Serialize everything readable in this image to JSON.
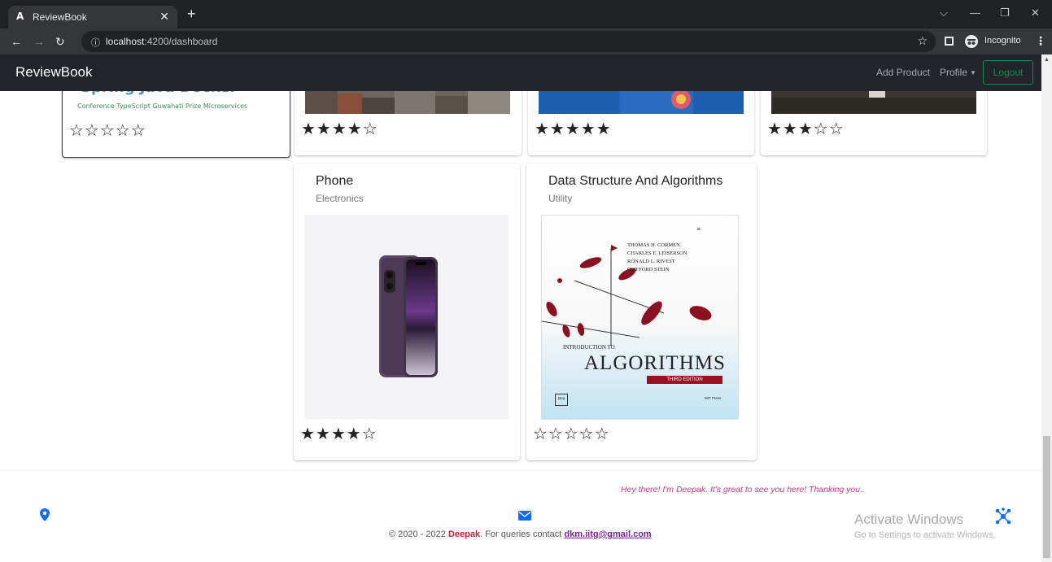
{
  "browser": {
    "tab_title": "ReviewBook",
    "tab_favicon": "A",
    "tab_close": "✕",
    "new_tab": "+",
    "url_host": "localhost",
    "url_rest": ":4200/dashboard",
    "incognito_label": "Incognito",
    "icons": [
      "back-arrow",
      "forward-arrow",
      "reload",
      "info",
      "bookmark-star",
      "side-panel",
      "incognito",
      "menu-kebab"
    ]
  },
  "navbar": {
    "brand": "ReviewBook",
    "add_product": "Add Product",
    "profile": "Profile",
    "logout": "Logout",
    "logout_color": "#198754"
  },
  "top_cards": [
    {
      "stars": "☆☆☆☆☆",
      "rating": 0,
      "image_text_1": "Spring Java Docker",
      "image_text_2": "Conference TypeScript Guwahati Prize Microservices"
    },
    {
      "stars": "★★★★☆",
      "rating": 4
    },
    {
      "stars": "★★★★★",
      "rating": 5
    },
    {
      "stars": "★★★☆☆",
      "rating": 3
    }
  ],
  "products": [
    {
      "title": "Phone",
      "category": "Electronics",
      "stars": "★★★★☆",
      "rating": 4
    },
    {
      "title": "Data Structure And Algorithms",
      "category": "Utility",
      "stars": "☆☆☆☆☆",
      "rating": 0,
      "book": {
        "authors": [
          "THOMAS H. CORMEN",
          "CHARLES E. LEISERSON",
          "RONALD L. RIVEST",
          "CLIFFORD STEIN"
        ],
        "intro": "INTRODUCTION TO",
        "title": "ALGORITHMS",
        "edition": "THIRD EDITION",
        "publisher_left": "PHI",
        "publisher_right": "MIT Press"
      }
    }
  ],
  "footer": {
    "message": "Hey there! I'm Deepak. It's great to see you here! Thanking you..",
    "copyright_prefix": "© 2020 - 2022 ",
    "name": "Deepak",
    "copyright_middle": ". For queries contact ",
    "email": "dkm.iitg@gmail.com",
    "accent": "#0d6efd"
  },
  "watermark": {
    "title": "Activate Windows",
    "subtitle": "Go to Settings to activate Windows."
  }
}
